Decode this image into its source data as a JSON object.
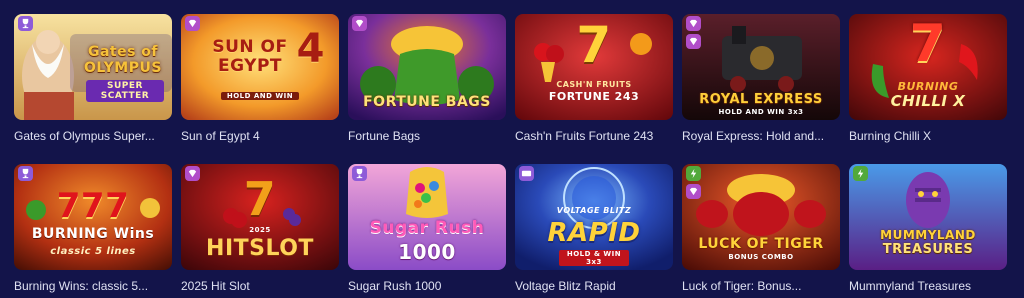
{
  "games": [
    {
      "title": "Gates of Olympus Super...",
      "logo_main": "Gates of OLYMPUS",
      "logo_sub": "SUPER SCATTER",
      "badges": [
        "trophy"
      ],
      "bg": [
        "#f2d37a",
        "#b8893d"
      ]
    },
    {
      "title": "Sun of Egypt 4",
      "logo_main": "SUN OF EGYPT",
      "logo_num": "4",
      "logo_sub": "HOLD AND WIN",
      "badges": [
        "gem"
      ],
      "bg": [
        "#f5b13a",
        "#c7521c"
      ]
    },
    {
      "title": "Fortune Bags",
      "logo_main": "FORTUNE BAGS",
      "badges": [
        "gem"
      ],
      "bg": [
        "#7a3fb0",
        "#2a0f5a"
      ]
    },
    {
      "title": "Cash'n Fruits Fortune 243",
      "logo_main": "7",
      "logo_sub": "CASH'N FRUITS",
      "logo_sub2": "FORTUNE 243",
      "badges": [],
      "bg": [
        "#c3131f",
        "#5e0509"
      ]
    },
    {
      "title": "Royal Express: Hold and...",
      "logo_main": "ROYAL EXPRESS",
      "logo_sub": "HOLD AND WIN 3x3",
      "badges": [
        "gem",
        "gem"
      ],
      "bg": [
        "#4a1a24",
        "#140708"
      ]
    },
    {
      "title": "Burning Chilli X",
      "logo_main": "7",
      "logo_sub": "BURNING",
      "logo_sub2": "CHILLI X",
      "badges": [],
      "bg": [
        "#a0161a",
        "#3d0608"
      ]
    },
    {
      "title": "Burning Wins: classic 5...",
      "logo_main": "BURNING Wins",
      "logo_sub": "classic 5 lines",
      "logo_num": "777",
      "badges": [
        "trophy"
      ],
      "bg": [
        "#d3451b",
        "#5c1306"
      ]
    },
    {
      "title": "2025 Hit Slot",
      "logo_main": "HITSLOT",
      "logo_num": "7",
      "logo_sub": "2025",
      "badges": [
        "gem"
      ],
      "bg": [
        "#b3161c",
        "#3e0609"
      ]
    },
    {
      "title": "Sugar Rush 1000",
      "logo_main": "Sugar Rush",
      "logo_sub": "1000",
      "badges": [
        "trophy"
      ],
      "bg": [
        "#e78bd2",
        "#8b4cc7"
      ]
    },
    {
      "title": "Voltage Blitz Rapid",
      "logo_main": "RAPID",
      "logo_sub": "VOLTAGE BLITZ",
      "logo_sub2": "HOLD & WIN 3x3",
      "badges": [
        "new"
      ],
      "bg": [
        "#3d6fe0",
        "#101e6b"
      ]
    },
    {
      "title": "Luck of Tiger: Bonus...",
      "logo_main": "LUCK OF TIGER",
      "logo_sub": "BONUS COMBO",
      "badges": [
        "bolt",
        "gem"
      ],
      "bg": [
        "#c7301c",
        "#4b0c06"
      ]
    },
    {
      "title": "Mummyland Treasures",
      "logo_main": "MUMMYLAND",
      "logo_sub": "TREASURES",
      "badges": [
        "bolt"
      ],
      "bg": [
        "#3a8ad8",
        "#5a1f85"
      ]
    }
  ],
  "colors": {
    "page_bg": "#13144a",
    "title_text": "#dfe1f3",
    "badge_purple": "#8e5bd8",
    "badge_green": "#52a93b"
  }
}
